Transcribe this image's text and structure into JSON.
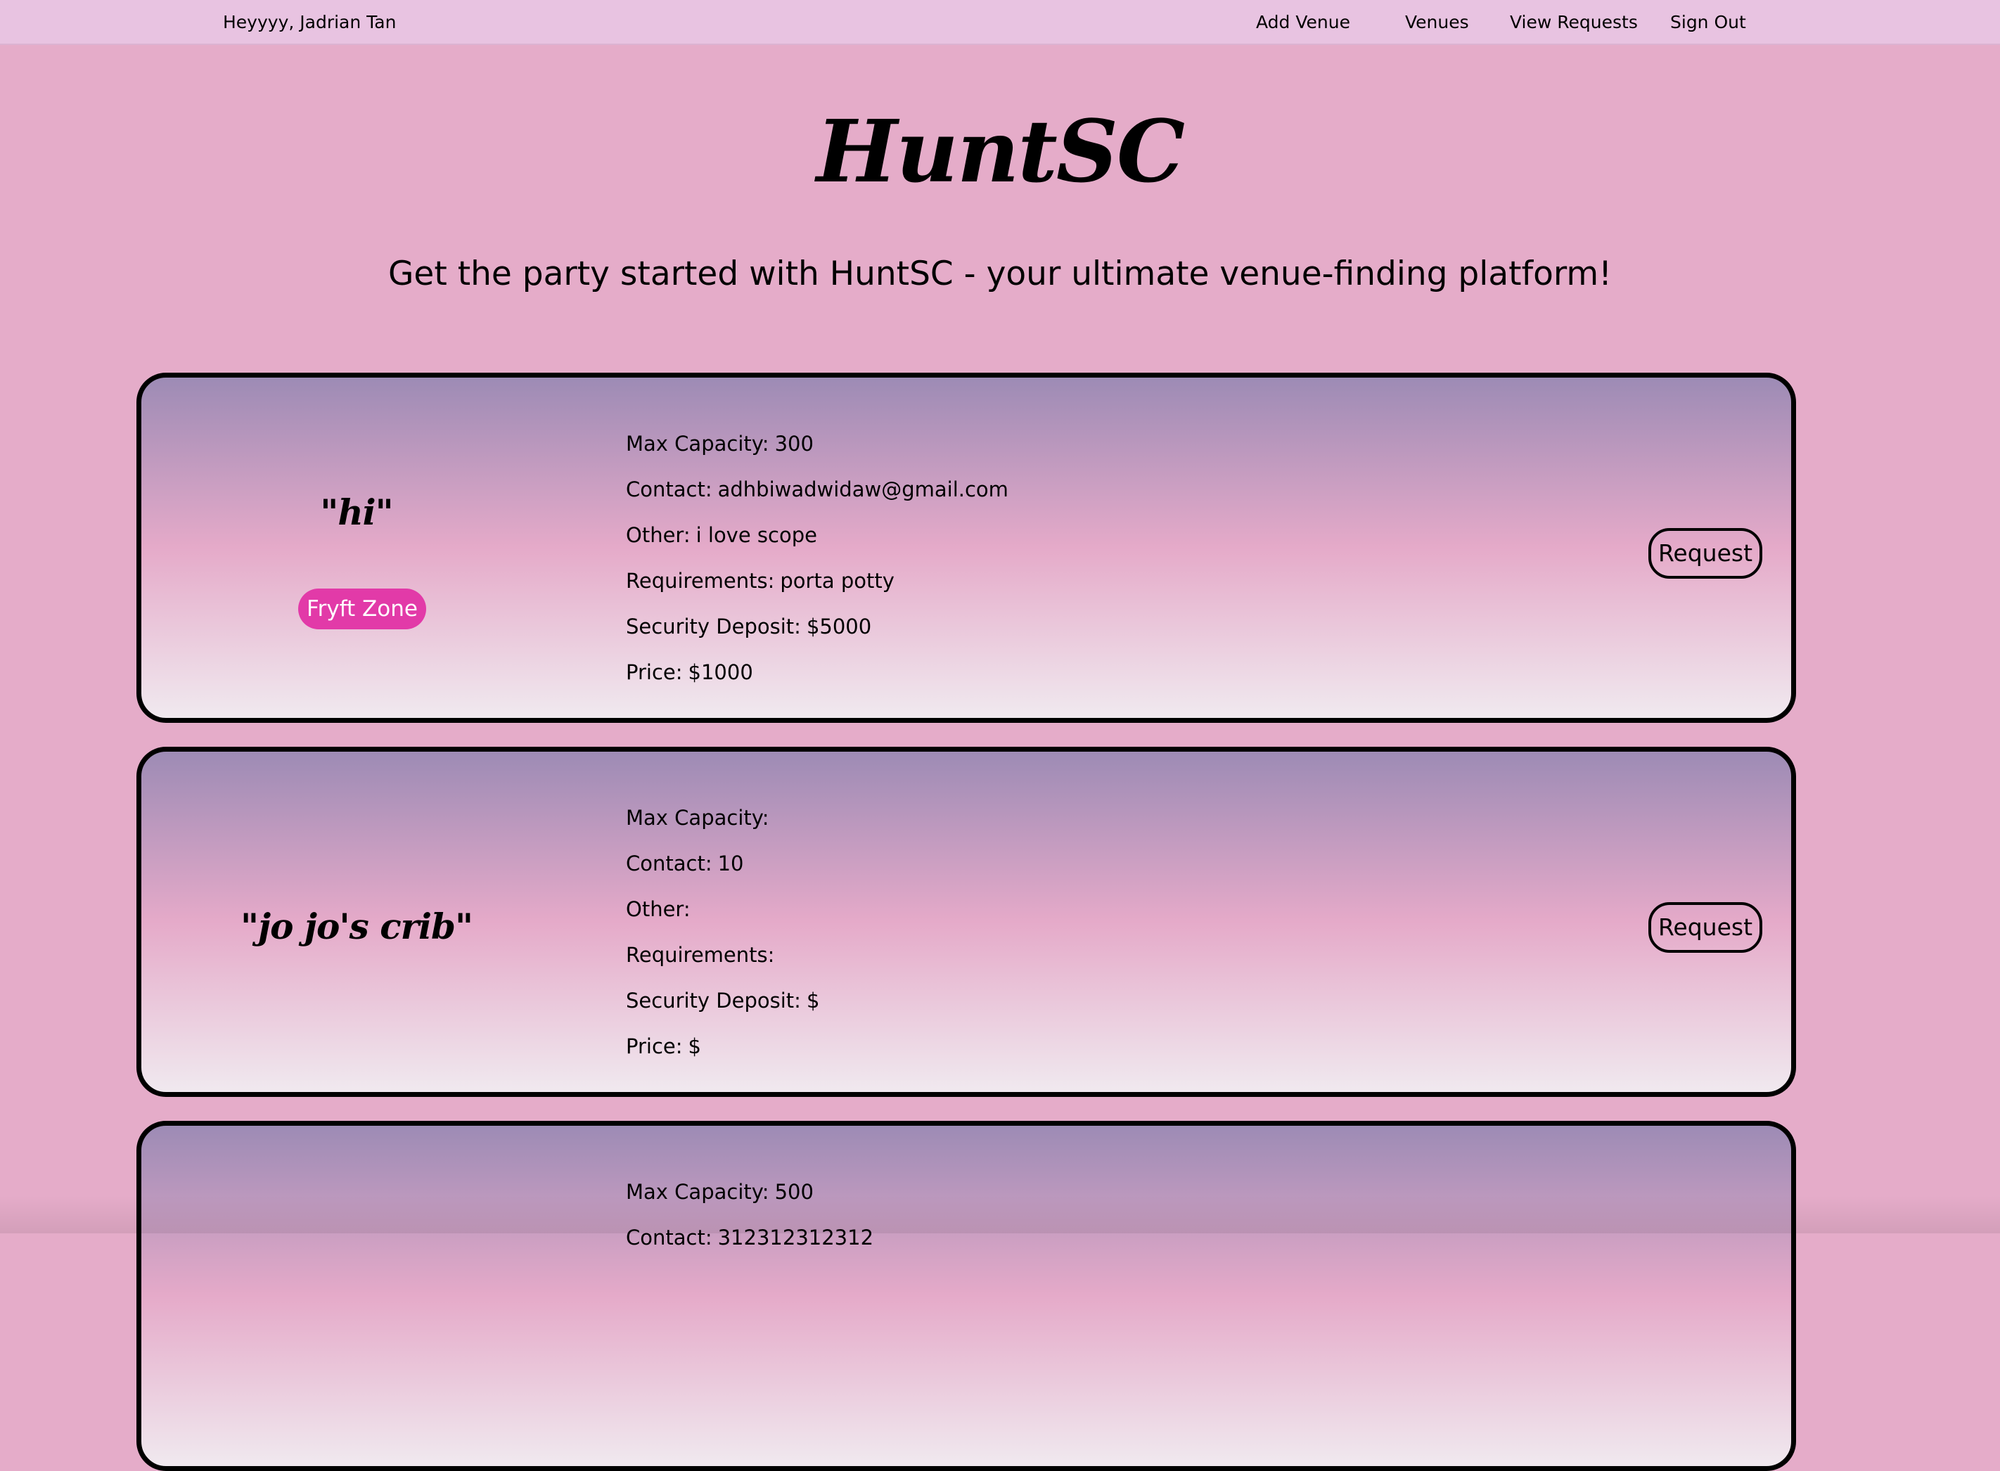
{
  "nav": {
    "greeting": "Heyyyy, Jadrian Tan",
    "links": [
      "Add Venue",
      "Venues",
      "View Requests",
      "Sign Out"
    ]
  },
  "brand": "HuntSC",
  "tagline": "Get the party started with HuntSC - your ultimate venue-finding platform!",
  "labels": {
    "max_capacity": "Max Capacity:",
    "contact": "Contact:",
    "other": "Other:",
    "requirements": "Requirements:",
    "security_deposit": "Security Deposit:",
    "price": "Price:"
  },
  "venues": [
    {
      "name": "\"hi\"",
      "tag": "Fryft Zone",
      "max_capacity": "300",
      "contact": "adhbiwadwidaw@gmail.com",
      "other": "i love scope",
      "requirements": "porta potty",
      "security_deposit": "$5000",
      "price": "$1000",
      "request_label": "Request"
    },
    {
      "name": "\"jo jo's crib\"",
      "max_capacity": "",
      "contact": "10",
      "other": "",
      "requirements": "",
      "security_deposit": "$",
      "price": "$",
      "request_label": "Request"
    },
    {
      "max_capacity": "500",
      "contact": "312312312312"
    }
  ],
  "colors": {
    "nav_bg": "#e8c3e1",
    "page_bg": "#e5acc9",
    "card_top": "#9d8bb5",
    "card_bottom": "#f0e9ef",
    "tag_bg": "#e23aa8"
  }
}
